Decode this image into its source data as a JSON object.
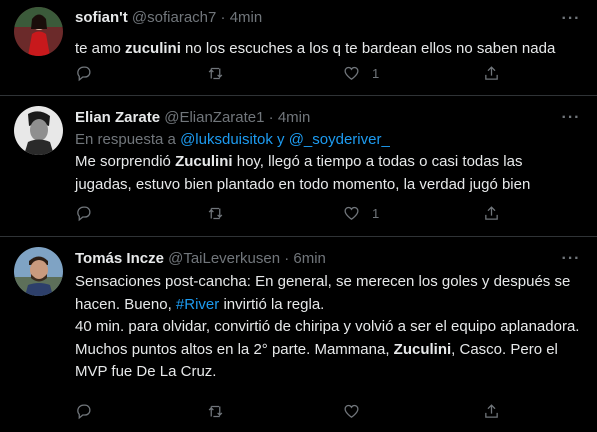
{
  "tweets": [
    {
      "name": "sofian't",
      "handle": "@sofiarach7",
      "sep": "·",
      "time": "4min",
      "text_parts": [
        "te amo ",
        "zuculini",
        " no los escuches a los q te bardean ellos no saben nada"
      ],
      "likes": "1",
      "avatar": "avatar-sofiant"
    },
    {
      "name": "Elian Zarate",
      "handle": "@ElianZarate1",
      "sep": "·",
      "time": "4min",
      "reply_prefix": "En respuesta a ",
      "reply_mention1": "@luksduisitok",
      "reply_join": " y ",
      "reply_mention2": "@_soyderiver_",
      "text_lines": {
        "p1": "Me sorprendió ",
        "b1": "Zuculini",
        "p2": " hoy, llegó a tiempo a todas o casi todas las jugadas, estuvo bien plantado en todo momento, la verdad jugó bien"
      },
      "likes": "1",
      "avatar": "avatar-elian"
    },
    {
      "name": "Tomás Incze",
      "handle": "@TaiLeverkusen",
      "sep": "·",
      "time": "6min",
      "text": {
        "p1": "Sensaciones post-cancha: En general, se merecen los goles y después se hacen. Bueno, ",
        "hashtag": "#River",
        "p2": " invirtió la regla.",
        "p3": "40 min. para olvidar, convirtió de chiripa y volvió a ser el equipo aplanadora.",
        "p4": "Muchos puntos altos en la 2° parte. Mammana, ",
        "b1": "Zuculini",
        "p5": ", Casco. Pero el MVP fue De La Cruz."
      },
      "likes": "",
      "avatar": "avatar-tomas"
    }
  ],
  "more_label": "···",
  "icons": {
    "reply": "reply-icon",
    "retweet": "retweet-icon",
    "like": "like-icon",
    "share": "share-icon"
  },
  "colors": {
    "background": "#000000",
    "text": "#e7e9ea",
    "secondary": "#71767b",
    "link": "#1d9bf0",
    "divider": "#2f3336"
  }
}
